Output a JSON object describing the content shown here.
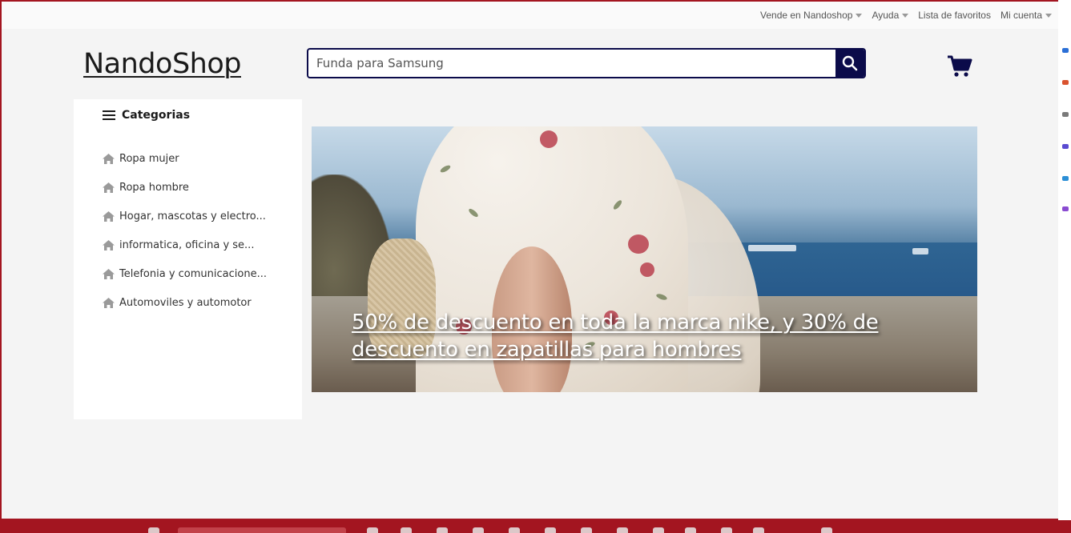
{
  "topbar": {
    "links": [
      {
        "label": "Vende en Nandoshop",
        "has_caret": true
      },
      {
        "label": "Ayuda",
        "has_caret": true
      },
      {
        "label": "Lista de favoritos",
        "has_caret": false
      },
      {
        "label": "Mi cuenta",
        "has_caret": true
      }
    ]
  },
  "header": {
    "logo": "NandoShop",
    "search_placeholder": "Funda para Samsung",
    "search_icon": "search-icon",
    "cart_icon": "shopping-cart-icon"
  },
  "sidebar": {
    "title": "Categorias",
    "title_icon": "menu-icon",
    "items": [
      {
        "label": "Ropa mujer",
        "icon": "home-icon"
      },
      {
        "label": "Ropa hombre",
        "icon": "home-icon"
      },
      {
        "label": "Hogar, mascotas y electro...",
        "icon": "home-icon"
      },
      {
        "label": "informatica, oficina y se...",
        "icon": "home-icon"
      },
      {
        "label": "Telefonia y comunicacione...",
        "icon": "home-icon"
      },
      {
        "label": "Automoviles y automotor",
        "icon": "home-icon"
      }
    ]
  },
  "hero": {
    "caption": "50% de descuento en toda la marca nike, y 30% de descuento en zapatillas para hombres"
  },
  "colors": {
    "brand_navy": "#0b0b4a",
    "page_bg": "#f4f4f4",
    "taskbar": "#a31520"
  }
}
